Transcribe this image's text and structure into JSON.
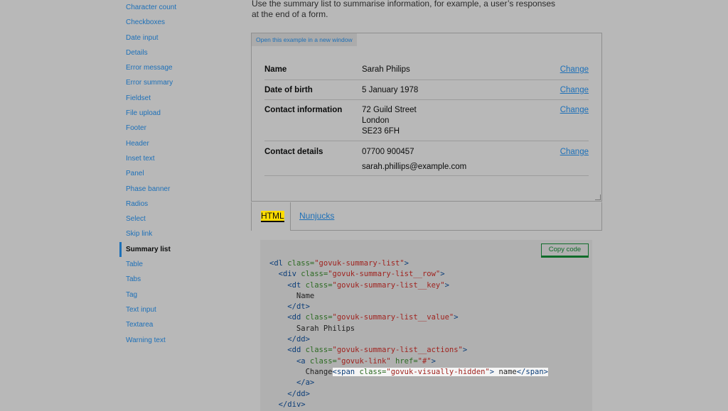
{
  "sidebar": {
    "items": [
      {
        "label": "Character count",
        "active": false
      },
      {
        "label": "Checkboxes",
        "active": false
      },
      {
        "label": "Date input",
        "active": false
      },
      {
        "label": "Details",
        "active": false
      },
      {
        "label": "Error message",
        "active": false
      },
      {
        "label": "Error summary",
        "active": false
      },
      {
        "label": "Fieldset",
        "active": false
      },
      {
        "label": "File upload",
        "active": false
      },
      {
        "label": "Footer",
        "active": false
      },
      {
        "label": "Header",
        "active": false
      },
      {
        "label": "Inset text",
        "active": false
      },
      {
        "label": "Panel",
        "active": false
      },
      {
        "label": "Phase banner",
        "active": false
      },
      {
        "label": "Radios",
        "active": false
      },
      {
        "label": "Select",
        "active": false
      },
      {
        "label": "Skip link",
        "active": false
      },
      {
        "label": "Summary list",
        "active": true
      },
      {
        "label": "Table",
        "active": false
      },
      {
        "label": "Tabs",
        "active": false
      },
      {
        "label": "Tag",
        "active": false
      },
      {
        "label": "Text input",
        "active": false
      },
      {
        "label": "Textarea",
        "active": false
      },
      {
        "label": "Warning text",
        "active": false
      }
    ]
  },
  "main": {
    "intro": "Use the summary list to summarise information, for example, a user’s responses at the end of a form.",
    "example": {
      "open_link": "Open this example in a new window",
      "rows": [
        {
          "key": "Name",
          "values": [
            "Sarah Philips"
          ],
          "action": "Change"
        },
        {
          "key": "Date of birth",
          "values": [
            "5 January 1978"
          ],
          "action": "Change"
        },
        {
          "key": "Contact information",
          "values": [
            "72 Guild Street",
            "London",
            "SE23 6FH"
          ],
          "action": "Change"
        },
        {
          "key": "Contact details",
          "values": [
            "07700 900457",
            "sarah.phillips@example.com"
          ],
          "action": "Change"
        }
      ]
    },
    "tabs": [
      {
        "label": "HTML",
        "selected": true
      },
      {
        "label": "Nunjucks",
        "selected": false
      }
    ],
    "copy_button": "Copy code",
    "code_lines": [
      [
        {
          "t": "tag",
          "v": "<dl "
        },
        {
          "t": "attr",
          "v": "class="
        },
        {
          "t": "str",
          "v": "\"govuk-summary-list\""
        },
        {
          "t": "tag",
          "v": ">"
        }
      ],
      [
        {
          "t": "plain",
          "v": "  "
        },
        {
          "t": "tag",
          "v": "<div "
        },
        {
          "t": "attr",
          "v": "class="
        },
        {
          "t": "str",
          "v": "\"govuk-summary-list__row\""
        },
        {
          "t": "tag",
          "v": ">"
        }
      ],
      [
        {
          "t": "plain",
          "v": "    "
        },
        {
          "t": "tag",
          "v": "<dt "
        },
        {
          "t": "attr",
          "v": "class="
        },
        {
          "t": "str",
          "v": "\"govuk-summary-list__key\""
        },
        {
          "t": "tag",
          "v": ">"
        }
      ],
      [
        {
          "t": "plain",
          "v": "      Name"
        }
      ],
      [
        {
          "t": "plain",
          "v": "    "
        },
        {
          "t": "tag",
          "v": "</dt>"
        }
      ],
      [
        {
          "t": "plain",
          "v": "    "
        },
        {
          "t": "tag",
          "v": "<dd "
        },
        {
          "t": "attr",
          "v": "class="
        },
        {
          "t": "str",
          "v": "\"govuk-summary-list__value\""
        },
        {
          "t": "tag",
          "v": ">"
        }
      ],
      [
        {
          "t": "plain",
          "v": "      Sarah Philips"
        }
      ],
      [
        {
          "t": "plain",
          "v": "    "
        },
        {
          "t": "tag",
          "v": "</dd>"
        }
      ],
      [
        {
          "t": "plain",
          "v": "    "
        },
        {
          "t": "tag",
          "v": "<dd "
        },
        {
          "t": "attr",
          "v": "class="
        },
        {
          "t": "str",
          "v": "\"govuk-summary-list__actions\""
        },
        {
          "t": "tag",
          "v": ">"
        }
      ],
      [
        {
          "t": "plain",
          "v": "      "
        },
        {
          "t": "tag",
          "v": "<a "
        },
        {
          "t": "attr",
          "v": "class="
        },
        {
          "t": "str",
          "v": "\"govuk-link\" "
        },
        {
          "t": "attr",
          "v": "href="
        },
        {
          "t": "str",
          "v": "\"#\""
        },
        {
          "t": "tag",
          "v": ">"
        }
      ],
      [
        {
          "t": "plain",
          "v": "        Change"
        },
        {
          "t": "tag",
          "v": "<span ",
          "hl": true
        },
        {
          "t": "attr",
          "v": "class=",
          "hl": true
        },
        {
          "t": "str",
          "v": "\"govuk-visually-hidden\"",
          "hl": true
        },
        {
          "t": "tag",
          "v": ">",
          "hl": true
        },
        {
          "t": "plain",
          "v": " name",
          "hl": true
        },
        {
          "t": "tag",
          "v": "</span>",
          "hl": true
        }
      ],
      [
        {
          "t": "plain",
          "v": "      "
        },
        {
          "t": "tag",
          "v": "</a>"
        }
      ],
      [
        {
          "t": "plain",
          "v": "    "
        },
        {
          "t": "tag",
          "v": "</dd>"
        }
      ],
      [
        {
          "t": "plain",
          "v": "  "
        },
        {
          "t": "tag",
          "v": "</div>"
        }
      ]
    ]
  },
  "colors": {
    "link": "#1d70b8",
    "focus": "#ffdd00",
    "button_green": "#0f6b2a",
    "overlay": "#b8b8b8"
  }
}
